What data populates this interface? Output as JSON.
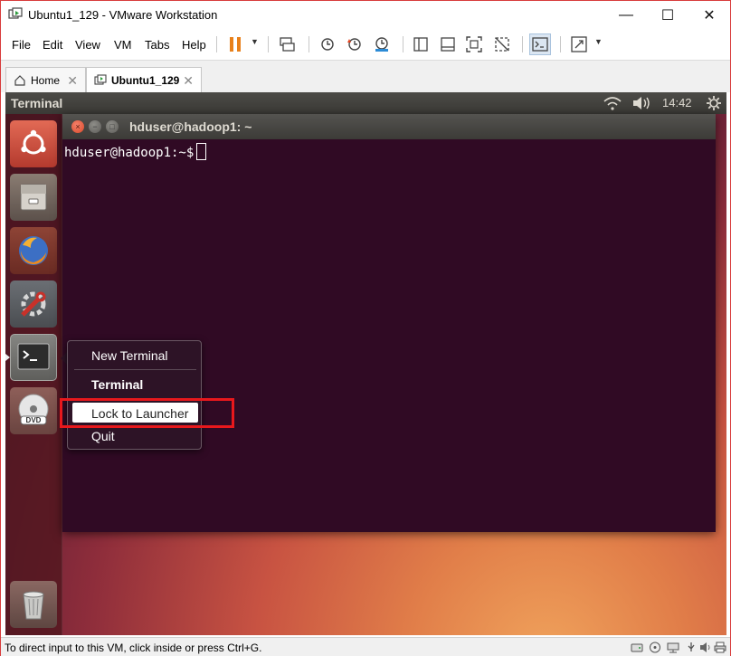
{
  "window": {
    "title": "Ubuntu1_129 - VMware Workstation",
    "minimize_glyph": "—",
    "maximize_glyph": "☐",
    "close_glyph": "✕"
  },
  "menu": {
    "file": "File",
    "edit": "Edit",
    "view": "View",
    "vm": "VM",
    "tabs": "Tabs",
    "help": "Help"
  },
  "toolbar": {
    "icons": [
      "pause-icon",
      "send-ctrl-alt-del-icon",
      "snapshot-icon",
      "revert-snapshot-icon",
      "snapshot-manager-icon",
      "library-view-icon",
      "thumbnail-bar-icon",
      "full-screen-icon",
      "unity-icon",
      "console-view-icon",
      "stretch-guest-icon"
    ],
    "accent_color": "#e8801a"
  },
  "tabs": [
    {
      "label": "Home",
      "close": "✕"
    },
    {
      "label": "Ubuntu1_129",
      "close": "✕"
    }
  ],
  "vm": {
    "panel": {
      "title": "Terminal",
      "time": "14:42",
      "icons": [
        "wifi-icon",
        "volume-icon",
        "settings-gear-icon"
      ]
    },
    "launcher": {
      "items": [
        "ubuntu-dash-icon",
        "files-icon",
        "firefox-icon",
        "system-settings-icon",
        "terminal-icon",
        "dvd-icon",
        "trash-icon"
      ]
    },
    "terminal": {
      "title": "hduser@hadoop1: ~",
      "prompt": "hduser@hadoop1:~$",
      "close_glyph": "×",
      "min_glyph": "−",
      "max_glyph": "□",
      "background": "#300a24"
    },
    "context_menu": {
      "items": [
        "New Terminal",
        "Terminal",
        "Lock to Launcher",
        "Quit"
      ],
      "highlighted": "Lock to Launcher",
      "highlight_color": "#e8181c"
    }
  },
  "statusbar": {
    "text": "To direct input to this VM, click inside or press Ctrl+G.",
    "icons": [
      "hard-disk-icon",
      "cd-dvd-icon",
      "network-icon",
      "usb-icon",
      "sound-icon",
      "printer-icon"
    ]
  }
}
